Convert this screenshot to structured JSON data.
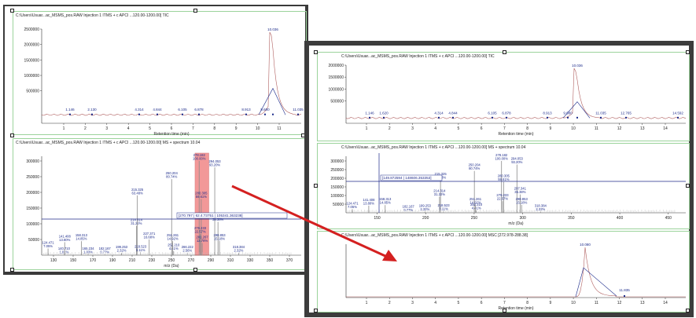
{
  "left_window": {
    "tic_title": "C:\\Users\\Usuar...ac_MSMS_pos.RAW Injection 1 ITMS + c APCI ...120.00-1200.00] TIC",
    "tic_xlabel": "Retention time (min)",
    "tic_yticks": [
      "2500000",
      "2000000",
      "1500000",
      "1000000",
      "500000"
    ],
    "tic_xticks": [
      "1",
      "2",
      "3",
      "4",
      "5",
      "6",
      "7",
      "8",
      "9",
      "10",
      "11"
    ],
    "tic_peaks": [
      "1.146",
      "2.130",
      "4.314",
      "4.844",
      "6.105",
      "6.878",
      "8.913",
      "9.680",
      "10.036",
      "11.035"
    ],
    "ms_title": "C:\\Users\\Usuar...ac_MSMS_pos.RAW Injection 1 ITMS + c APCI ...120.00-1200.00] MS + spectrum 10.04",
    "ms_xlabel": "m/z (Da)",
    "ms_yticks": [
      "300000",
      "250000",
      "200000",
      "150000",
      "100000",
      "50000"
    ],
    "ms_xticks": [
      "130",
      "150",
      "170",
      "190",
      "210",
      "230",
      "250",
      "270",
      "290",
      "310",
      "330",
      "350",
      "370"
    ],
    "cursor_readout": "[270.797 | 62.4:73751 | 105341.363238]",
    "ms_labels": [
      {
        "mz": "124.471",
        "pct": "7.05%"
      },
      {
        "mz": "140.710",
        "pct": "1.01%"
      },
      {
        "mz": "141.408",
        "pct": "13.80%"
      },
      {
        "mz": "158.313",
        "pct": "14.85%"
      },
      {
        "mz": "165.234",
        "pct": "1.03%"
      },
      {
        "mz": "182.167",
        "pct": "0.77%"
      },
      {
        "mz": "199.253",
        "pct": "2.32%"
      },
      {
        "mz": "214.314",
        "pct": "31.22%"
      },
      {
        "mz": "215.325",
        "pct": "63.48%"
      },
      {
        "mz": "218.523",
        "pct": "3.11%"
      },
      {
        "mz": "227.371",
        "pct": "16.68%"
      },
      {
        "mz": "250.204",
        "pct": "80.74%"
      },
      {
        "mz": "252.210",
        "pct": "4.41%"
      },
      {
        "mz": "251.261",
        "pct": "14.92%"
      },
      {
        "mz": "266.222",
        "pct": "2.56%"
      },
      {
        "mz": "278.182",
        "pct": "100.00%"
      },
      {
        "mz": "280.305",
        "pct": "59.61%"
      },
      {
        "mz": "279.233",
        "pct": "22.57%"
      },
      {
        "mz": "281.267",
        "pct": "12.78%"
      },
      {
        "mz": "294.053",
        "pct": "93.20%"
      },
      {
        "mz": "297.341",
        "pct": "35.38%"
      },
      {
        "mz": "298.853",
        "pct": "15.18%"
      },
      {
        "mz": "318.384",
        "pct": "2.32%"
      }
    ]
  },
  "right_window": {
    "tic_title": "C:\\Users\\Usuar...ac_MSMS_pos.RAW Injection 1 ITMS + c APCI ...120.00-1200.00] TIC",
    "tic_xlabel": "Retention time (min)",
    "tic_yticks": [
      "2000000",
      "1500000",
      "1000000",
      "500000"
    ],
    "tic_xticks": [
      "1",
      "2",
      "3",
      "4",
      "5",
      "6",
      "7",
      "8",
      "9",
      "10",
      "11",
      "12",
      "13",
      "14"
    ],
    "tic_peaks": [
      "1.146",
      "1.620",
      "4.314",
      "4.844",
      "6.105",
      "6.878",
      "8.913",
      "9.680",
      "10.036",
      "11.035",
      "12.765",
      "14.592"
    ],
    "ms_title": "C:\\Users\\Usuar...ac_MSMS_pos.RAW Injection 1 ITMS + c APCI ...120.00-1200.00] MS + spectrum 10.04",
    "ms_xlabel": "m/z (Da)",
    "ms_yticks": [
      "300000",
      "250000",
      "200000",
      "150000",
      "100000",
      "50000"
    ],
    "ms_xticks": [
      "150",
      "200",
      "250",
      "300",
      "350",
      "400",
      "450"
    ],
    "cursor_readout": "[149.872594 | 148606.353353]",
    "ms_labels": [
      {
        "mz": "124.471",
        "pct": "7.05%"
      },
      {
        "mz": "141.408",
        "pct": "13.80%"
      },
      {
        "mz": "158.313",
        "pct": "14.85%"
      },
      {
        "mz": "182.167",
        "pct": "0.77%"
      },
      {
        "mz": "199.253",
        "pct": "2.32%"
      },
      {
        "mz": "215.325",
        "pct": "63.48%"
      },
      {
        "mz": "214.314",
        "pct": "31.22%"
      },
      {
        "mz": "218.523",
        "pct": "3.11%"
      },
      {
        "mz": "250.204",
        "pct": "80.74%"
      },
      {
        "mz": "252.210",
        "pct": "4.41%"
      },
      {
        "mz": "251.261",
        "pct": "14.92%"
      },
      {
        "mz": "278.182",
        "pct": "100.00%"
      },
      {
        "mz": "280.305",
        "pct": "59.61%"
      },
      {
        "mz": "279.233",
        "pct": "22.57%"
      },
      {
        "mz": "294.053",
        "pct": "93.20%"
      },
      {
        "mz": "297.341",
        "pct": "35.38%"
      },
      {
        "mz": "298.853",
        "pct": "15.18%"
      },
      {
        "mz": "318.384",
        "pct": "2.32%"
      }
    ],
    "msc_title": "C:\\Users\\Usuar...ac_MSMS_pos.RAW Injection 1 ITMS + c APCI ...120.00-1200.00] MSC [272.978-288.38]",
    "msc_xlabel": "Retention time (min)",
    "msc_xticks": [
      "1",
      "2",
      "3",
      "4",
      "5",
      "6",
      "7",
      "8",
      "9",
      "10",
      "11",
      "12",
      "13",
      "14"
    ],
    "msc_peaks": [
      "10.080",
      "11.835"
    ]
  },
  "colors": {
    "trace": "#b06060",
    "peak_marker": "#1b2a8a",
    "threshold_line": "#1f2a8a",
    "selection_fill": "#e84545",
    "panel_border": "#9bd39b",
    "arrow": "#d42020"
  }
}
